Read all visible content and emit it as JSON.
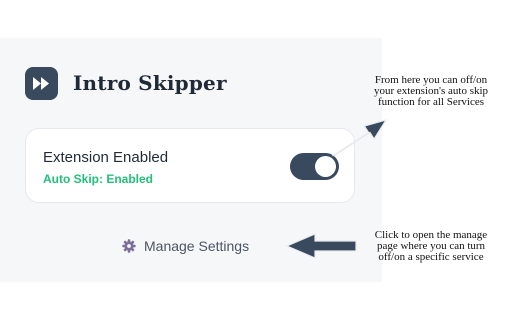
{
  "app": {
    "title": "Intro Skipper",
    "logo_icon": "fast-forward-icon"
  },
  "status_card": {
    "title": "Extension Enabled",
    "subtitle": "Auto Skip: Enabled",
    "toggle_state": "on"
  },
  "manage": {
    "label": "Manage Settings",
    "icon": "gear-icon"
  },
  "annotations": {
    "top": [
      "From here you can off/on",
      "your extension's auto skip",
      "function for all Services"
    ],
    "bottom": [
      "Click to open the manage",
      "page where you can turn",
      "off/on a specific service"
    ]
  },
  "colors": {
    "panel_background": "#f6f7f9",
    "accent_dark": "#394a5e",
    "enabled_green": "#22c07a",
    "arrow_fill": "#394a5e"
  }
}
